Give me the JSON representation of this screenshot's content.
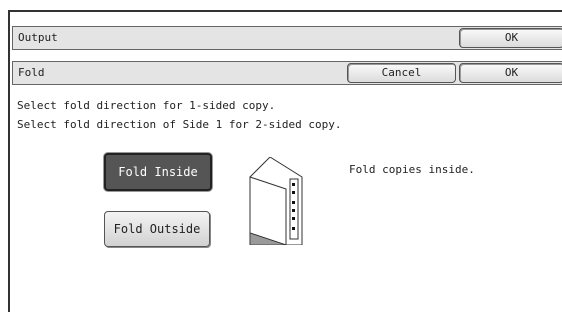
{
  "header": {
    "title": "Output",
    "ok_label": "OK"
  },
  "subheader": {
    "title": "Fold",
    "cancel_label": "Cancel",
    "ok_label": "OK"
  },
  "instructions": {
    "line1": "Select fold direction for 1-sided copy.",
    "line2": "Select fold direction of Side 1 for 2-sided copy."
  },
  "options": {
    "fold_inside": {
      "label": "Fold Inside",
      "selected": true
    },
    "fold_outside": {
      "label": "Fold Outside",
      "selected": false
    }
  },
  "description": "Fold copies inside.",
  "icon": "fold-inside-illustration"
}
